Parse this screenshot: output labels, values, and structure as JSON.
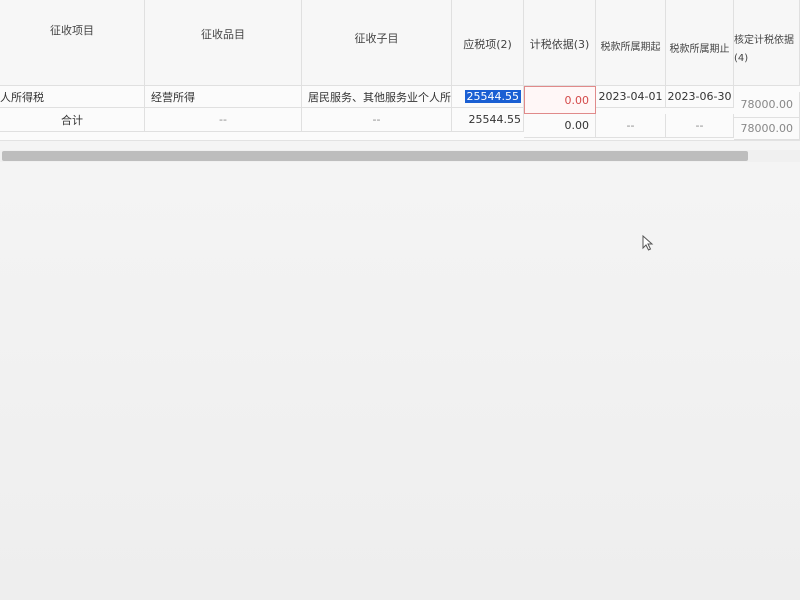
{
  "table": {
    "headers": {
      "item": "征收项目",
      "category": "征收品目",
      "subcategory": "征收子目",
      "taxable": "应税项(2)",
      "basis": "计税依据(3)",
      "period_start": "税款所属期起",
      "period_end": "税款所属期止",
      "assessed_line1": "核定计税依据",
      "assessed_line2": "(4)"
    },
    "row": {
      "item": "人所得税",
      "category": "经营所得",
      "subcategory": "居民服务、其他服务业个人所得",
      "taxable": "25544.55",
      "basis": "0.00",
      "period_start": "2023-04-01",
      "period_end": "2023-06-30",
      "assessed": "78000.00"
    },
    "total": {
      "label": "合计",
      "category": "--",
      "subcategory": "--",
      "taxable": "25544.55",
      "basis": "0.00",
      "period_start": "--",
      "period_end": "--",
      "assessed": "78000.00"
    }
  },
  "colors": {
    "selection": "#1a5fd3",
    "error_border": "#e08a8a",
    "error_text": "#d44a4a"
  },
  "icons": {
    "cursor": "mouse-pointer-icon"
  }
}
